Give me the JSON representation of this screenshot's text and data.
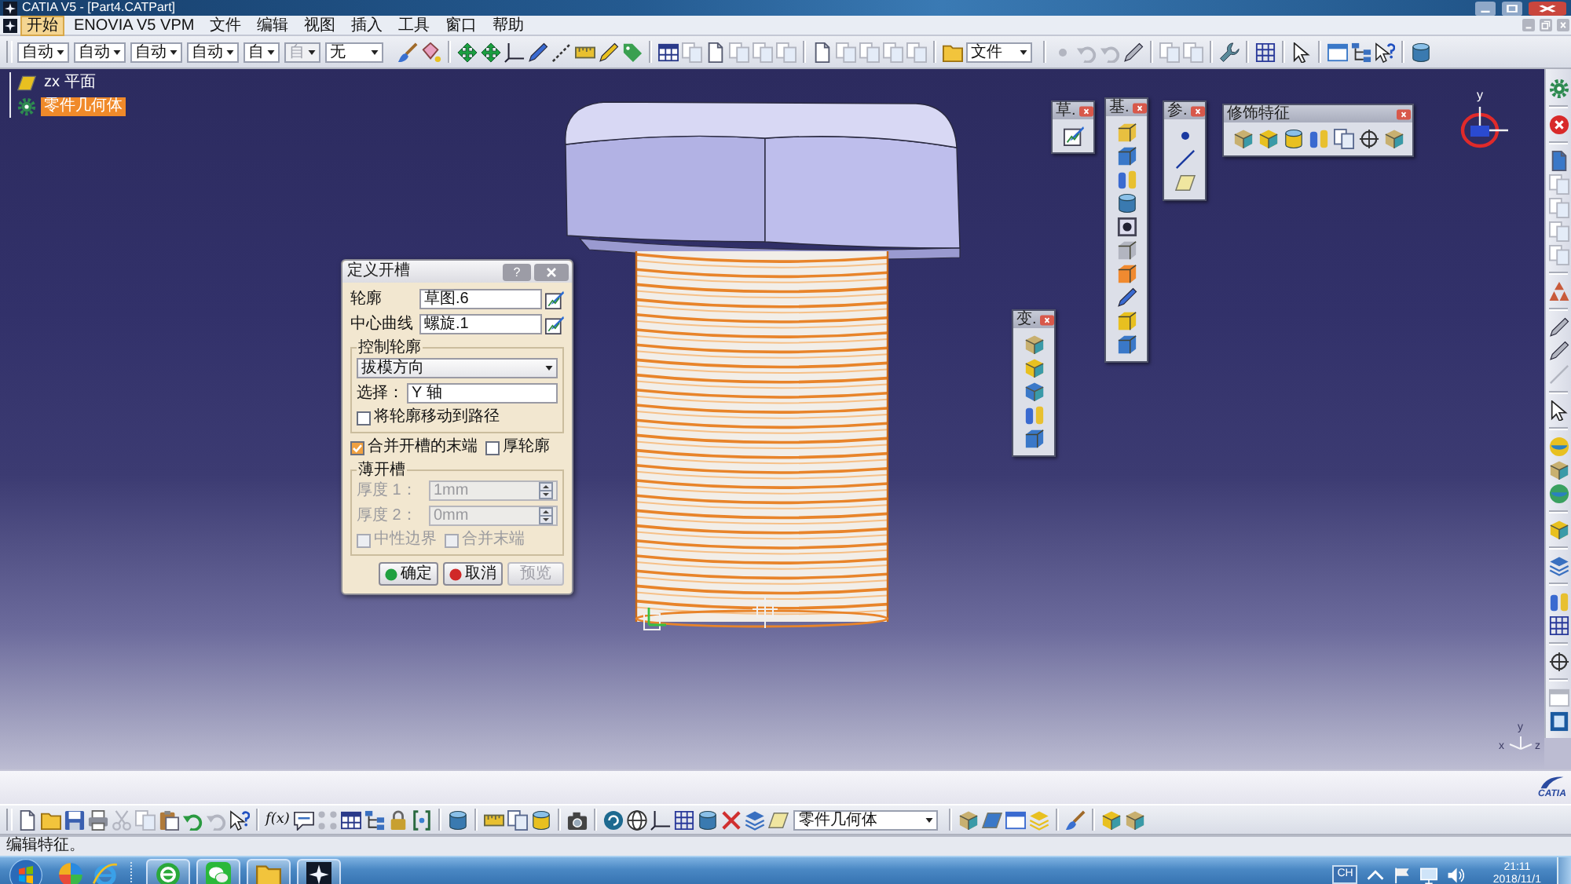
{
  "window": {
    "title": "CATIA V5 - [Part4.CATPart]"
  },
  "menu": [
    {
      "label": "开始",
      "selected": true
    },
    {
      "label": "ENOVIA V5 VPM",
      "selected": false
    },
    {
      "label": "文件",
      "selected": false
    },
    {
      "label": "编辑",
      "selected": false
    },
    {
      "label": "视图",
      "selected": false
    },
    {
      "label": "插入",
      "selected": false
    },
    {
      "label": "工具",
      "selected": false
    },
    {
      "label": "窗口",
      "selected": false
    },
    {
      "label": "帮助",
      "selected": false
    }
  ],
  "toolbar": {
    "style_dropdowns": [
      {
        "value": "自动",
        "disabled": false
      },
      {
        "value": "自动",
        "disabled": false
      },
      {
        "value": "自动",
        "disabled": false
      },
      {
        "value": "自动",
        "disabled": false
      },
      {
        "value": "自",
        "disabled": false
      },
      {
        "value": "自",
        "disabled": true
      },
      {
        "value": "无",
        "disabled": false
      }
    ],
    "file_dropdown": "文件"
  },
  "tree": [
    {
      "label": "zx 平面",
      "selected": false
    },
    {
      "label": "零件几何体",
      "selected": true
    }
  ],
  "dialog": {
    "title": "定义开槽",
    "help_button": "?",
    "fields": [
      {
        "label": "轮廓",
        "value": "草图.6"
      },
      {
        "label": "中心曲线",
        "value": "螺旋.1"
      }
    ],
    "control_profile": {
      "title": "控制轮廓",
      "mode": "拔模方向",
      "selection_label": "选择：",
      "selection_value": "Y 轴",
      "move_profile": {
        "label": "将轮廓移动到路径",
        "checked": false
      }
    },
    "options": [
      {
        "label": "合并开槽的末端",
        "checked": true
      },
      {
        "label": "厚轮廓",
        "checked": false
      }
    ],
    "thin_groove": {
      "title": "薄开槽",
      "disabled": true,
      "thicknesses": [
        {
          "label": "厚度 1：",
          "value": "1mm"
        },
        {
          "label": "厚度 2：",
          "value": "0mm"
        }
      ],
      "options": [
        {
          "label": "中性边界",
          "checked": false
        },
        {
          "label": "合并末端",
          "checked": false
        }
      ]
    },
    "buttons": [
      {
        "label": "确定",
        "kind": "ok",
        "disabled": false
      },
      {
        "label": "取消",
        "kind": "cancel",
        "disabled": false
      },
      {
        "label": "预览",
        "kind": "preview",
        "disabled": true
      }
    ]
  },
  "floating_toolbars": [
    {
      "title": "草."
    },
    {
      "title": "基."
    },
    {
      "title": "参."
    },
    {
      "title": "修饰特征"
    },
    {
      "title": "变."
    }
  ],
  "compass": {
    "axis_label": "y"
  },
  "axis_triad": {
    "labels": [
      "y",
      "x",
      "z"
    ]
  },
  "logo": "CATIA",
  "bottom_toolbar": {
    "formula_button": "f(x)",
    "body_dropdown": "零件几何体"
  },
  "status_bar": "编辑特征。",
  "taskbar": {
    "language": "CH",
    "time": "21:11",
    "date": "2018/11/1"
  }
}
